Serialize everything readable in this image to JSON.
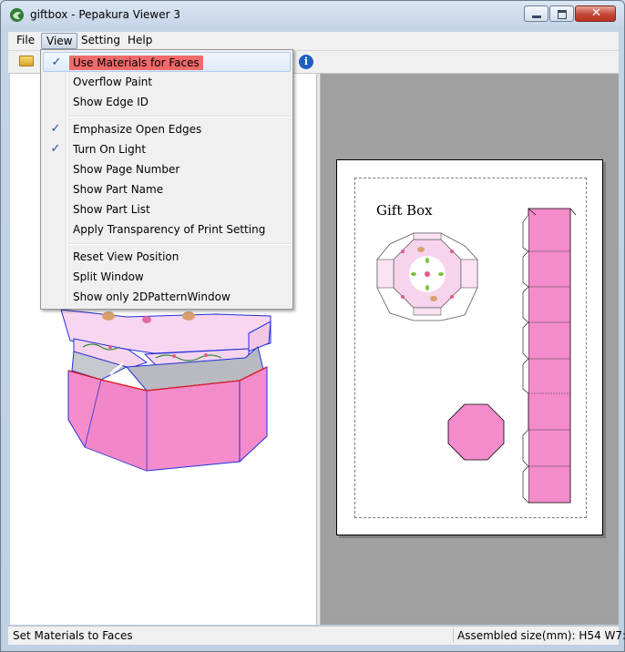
{
  "window": {
    "title": "giftbox - Pepakura Viewer 3",
    "close_glyph": "✕"
  },
  "menubar": {
    "file": "File",
    "view": "View",
    "setting": "Setting",
    "help": "Help"
  },
  "toolbar": {
    "info_glyph": "i"
  },
  "view_menu": {
    "items": [
      {
        "label": "Use Materials for Faces",
        "checked": true
      },
      {
        "label": "Overflow Paint",
        "checked": false
      },
      {
        "label": "Show Edge ID",
        "checked": false
      },
      {
        "label": "Emphasize Open Edges",
        "checked": true
      },
      {
        "label": "Turn On Light",
        "checked": true
      },
      {
        "label": "Show Page Number",
        "checked": false
      },
      {
        "label": "Show Part Name",
        "checked": false
      },
      {
        "label": "Show Part List",
        "checked": false
      },
      {
        "label": "Apply Transparency of Print Setting",
        "checked": false
      },
      {
        "label": "Reset View Position",
        "checked": false
      },
      {
        "label": "Split Window",
        "checked": false
      },
      {
        "label": "Show only 2DPatternWindow",
        "checked": false
      }
    ],
    "check_glyph": "✓"
  },
  "pattern": {
    "title": "Gift Box"
  },
  "colors": {
    "box_pink": "#f48ccc",
    "lid_pink": "#f7d4ee",
    "edge_blue": "#1f2fd8",
    "edge_red": "#e01818"
  },
  "statusbar": {
    "left": "Set Materials to Faces",
    "right": "Assembled size(mm): H54 W7:"
  }
}
